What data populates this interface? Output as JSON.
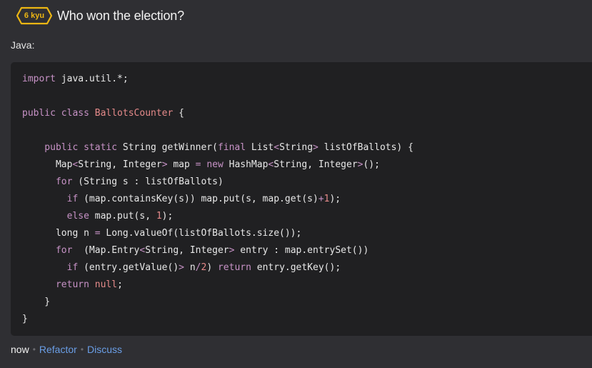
{
  "header": {
    "rank_label": "6 kyu",
    "title": "Who won the election?",
    "badge_color": "#ecb613"
  },
  "language_label": "Java:",
  "code_lines": [
    [
      {
        "t": "import",
        "c": "kw"
      },
      {
        "t": " java.util.*;",
        "c": ""
      }
    ],
    [],
    [
      {
        "t": "public class ",
        "c": "kw"
      },
      {
        "t": "BallotsCounter",
        "c": "cls"
      },
      {
        "t": " {",
        "c": ""
      }
    ],
    [],
    [
      {
        "t": "    public static ",
        "c": "kw"
      },
      {
        "t": "String getWinner(",
        "c": ""
      },
      {
        "t": "final",
        "c": "kw"
      },
      {
        "t": " List",
        "c": ""
      },
      {
        "t": "<",
        "c": "kw"
      },
      {
        "t": "String",
        "c": ""
      },
      {
        "t": ">",
        "c": "kw"
      },
      {
        "t": " listOfBallots) {",
        "c": ""
      }
    ],
    [
      {
        "t": "      Map",
        "c": ""
      },
      {
        "t": "<",
        "c": "kw"
      },
      {
        "t": "String, Integer",
        "c": ""
      },
      {
        "t": ">",
        "c": "kw"
      },
      {
        "t": " map ",
        "c": ""
      },
      {
        "t": "=",
        "c": "kw"
      },
      {
        "t": " ",
        "c": ""
      },
      {
        "t": "new",
        "c": "kw"
      },
      {
        "t": " HashMap",
        "c": ""
      },
      {
        "t": "<",
        "c": "kw"
      },
      {
        "t": "String, Integer",
        "c": ""
      },
      {
        "t": ">",
        "c": "kw"
      },
      {
        "t": "();",
        "c": ""
      }
    ],
    [
      {
        "t": "      for",
        "c": "kw"
      },
      {
        "t": " (String s : listOfBallots)",
        "c": ""
      }
    ],
    [
      {
        "t": "        if",
        "c": "kw"
      },
      {
        "t": " (map.containsKey(s)) map.put(s, map.get(s)",
        "c": ""
      },
      {
        "t": "+",
        "c": "kw"
      },
      {
        "t": "1",
        "c": "num"
      },
      {
        "t": ");",
        "c": ""
      }
    ],
    [
      {
        "t": "        else",
        "c": "kw"
      },
      {
        "t": " map.put(s, ",
        "c": ""
      },
      {
        "t": "1",
        "c": "num"
      },
      {
        "t": ");",
        "c": ""
      }
    ],
    [
      {
        "t": "      long n ",
        "c": ""
      },
      {
        "t": "=",
        "c": "kw"
      },
      {
        "t": " Long.valueOf(listOfBallots.size());",
        "c": ""
      }
    ],
    [
      {
        "t": "      for",
        "c": "kw"
      },
      {
        "t": "  (Map.Entry",
        "c": ""
      },
      {
        "t": "<",
        "c": "kw"
      },
      {
        "t": "String, Integer",
        "c": ""
      },
      {
        "t": ">",
        "c": "kw"
      },
      {
        "t": " entry : map.entrySet())",
        "c": ""
      }
    ],
    [
      {
        "t": "        if",
        "c": "kw"
      },
      {
        "t": " (entry.getValue()",
        "c": ""
      },
      {
        "t": ">",
        "c": "kw"
      },
      {
        "t": " n",
        "c": ""
      },
      {
        "t": "/",
        "c": "kw"
      },
      {
        "t": "2",
        "c": "num"
      },
      {
        "t": ") ",
        "c": ""
      },
      {
        "t": "return",
        "c": "kw"
      },
      {
        "t": " entry.getKey();",
        "c": ""
      }
    ],
    [
      {
        "t": "      return",
        "c": "kw"
      },
      {
        "t": " ",
        "c": ""
      },
      {
        "t": "null",
        "c": "num"
      },
      {
        "t": ";",
        "c": ""
      }
    ],
    [
      {
        "t": "    }",
        "c": ""
      }
    ],
    [
      {
        "t": "}",
        "c": ""
      }
    ]
  ],
  "footer": {
    "time": "now",
    "separator": "•",
    "refactor": "Refactor",
    "discuss": "Discuss"
  }
}
